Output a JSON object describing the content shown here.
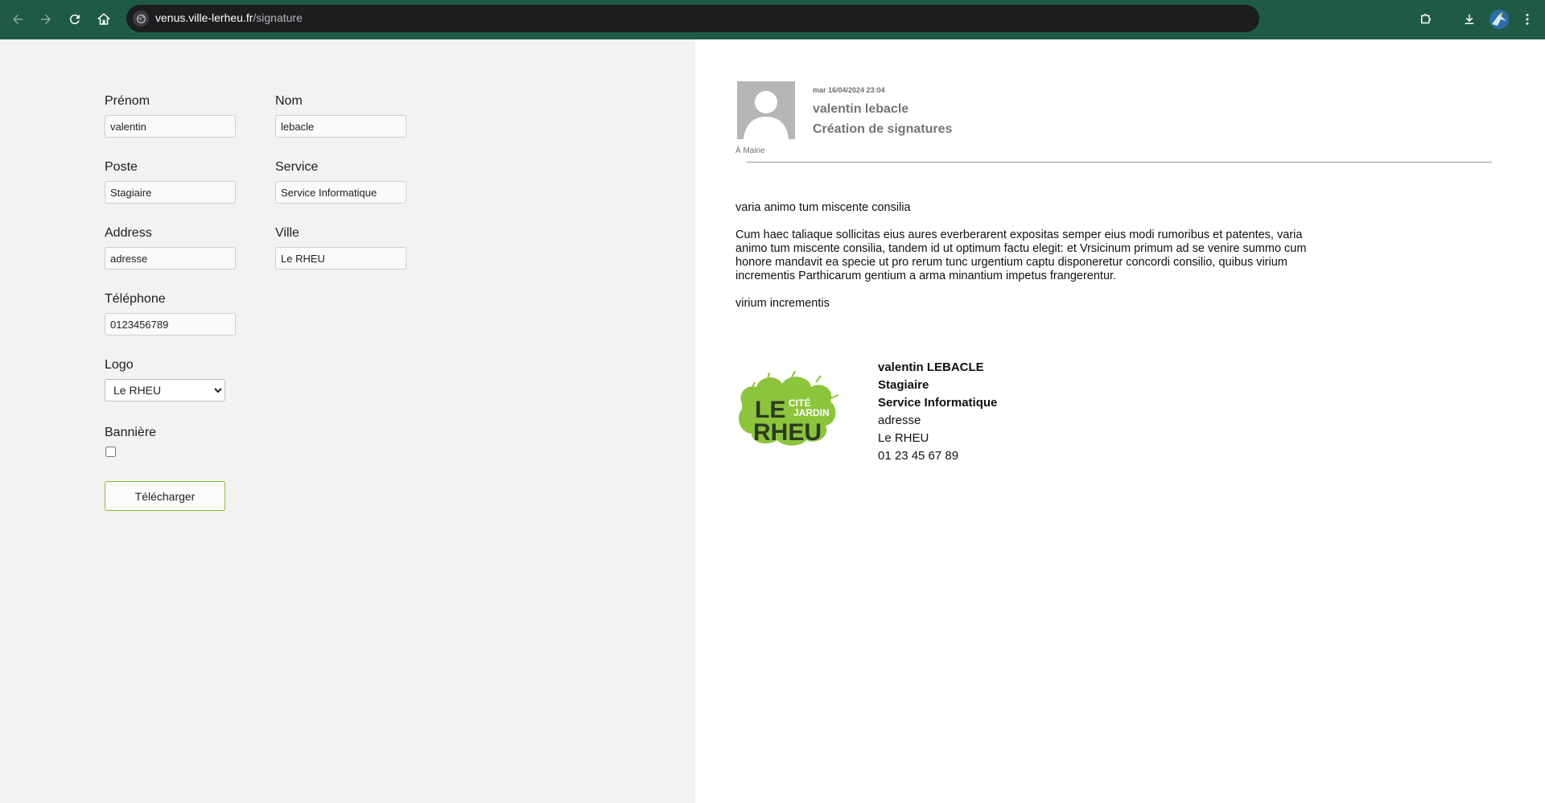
{
  "browser": {
    "url_host": "venus.ville-lerheu.fr",
    "url_path": "/signature"
  },
  "form": {
    "firstname": {
      "label": "Prénom",
      "value": "valentin"
    },
    "lastname": {
      "label": "Nom",
      "value": "lebacle"
    },
    "position": {
      "label": "Poste",
      "value": "Stagiaire"
    },
    "service": {
      "label": "Service",
      "value": "Service Informatique"
    },
    "address": {
      "label": "Address",
      "value": "adresse"
    },
    "city": {
      "label": "Ville",
      "value": "Le RHEU"
    },
    "phone": {
      "label": "Téléphone",
      "value": "0123456789"
    },
    "logo": {
      "label": "Logo",
      "selected": "Le RHEU"
    },
    "banner": {
      "label": "Bannière",
      "checked": false
    },
    "download_label": "Télécharger"
  },
  "preview": {
    "date": "mar 16/04/2024 23:04",
    "sender": "valentin lebacle",
    "subject": "Création de signatures",
    "to": "À Mairie",
    "body": {
      "p1": "varia animo tum miscente consilia",
      "p2": "Cum haec taliaque sollicitas eius aures everberarent expositas semper eius modi rumoribus et patentes, varia animo tum miscente consilia, tandem id ut optimum factu elegit: et Vrsicinum primum ad se venire summo cum honore mandavit ea specie ut pro rerum tunc urgentium captu disponeretur concordi consilio, quibus virium incrementis Parthicarum gentium a arma minantium impetus frangerentur.",
      "p3": "virium incrementis"
    },
    "signature": {
      "logo_line1": "LE",
      "logo_line2": "RHEU",
      "logo_tag1": "CITÉ",
      "logo_tag2": "JARDIN",
      "name": "valentin LEBACLE",
      "position": "Stagiaire",
      "service": "Service Informatique",
      "address": "adresse",
      "city": "Le RHEU",
      "phone": "01 23 45 67 89"
    }
  },
  "colors": {
    "chrome_bg": "#1f5b44",
    "urlbar_bg": "#1c1d1f",
    "accent_green": "#8bbd3a",
    "form_bg": "#f2f2f2"
  }
}
